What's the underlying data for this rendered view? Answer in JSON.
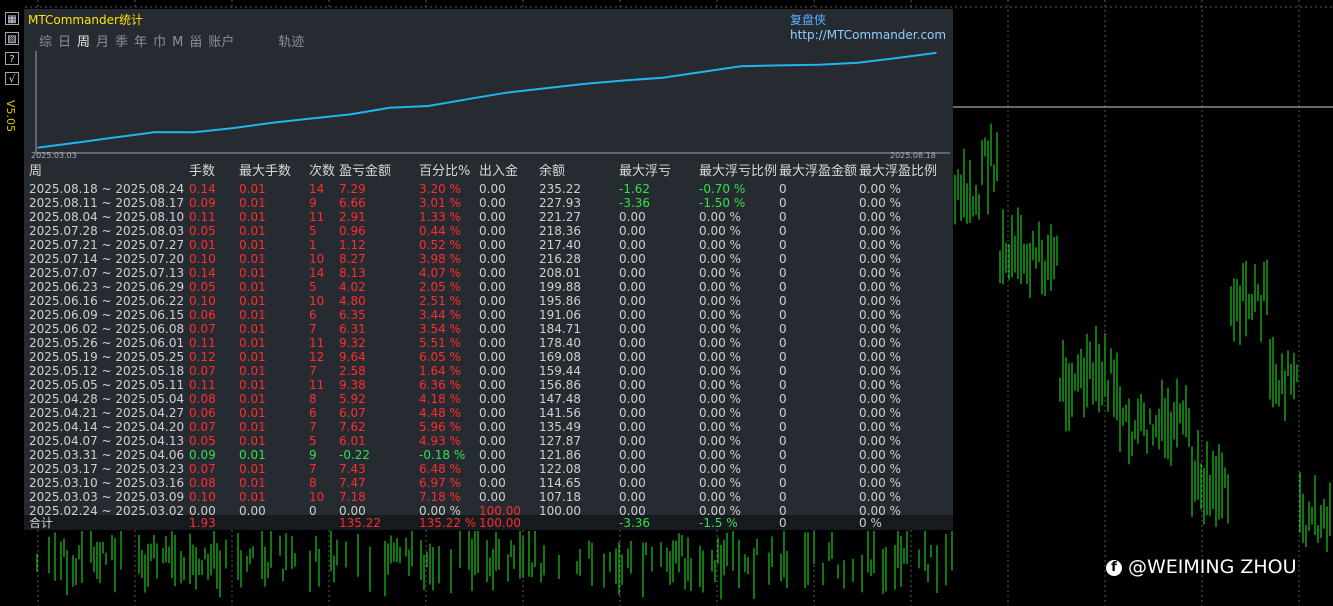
{
  "panel": {
    "title": "MTCommander统计",
    "brand": "复盘侠",
    "url": "http://MTCommander.com",
    "version": "V5.05"
  },
  "toolbar_icons": [
    "grid-icon",
    "calculator-icon",
    "help-icon",
    "check-icon"
  ],
  "toolbar_glyphs": [
    "▦",
    "▨",
    "?",
    "√"
  ],
  "tabs": [
    "综",
    "日",
    "周",
    "月",
    "季",
    "年",
    "巾",
    "M",
    "甾",
    "账户"
  ],
  "active_tab": 2,
  "trajectory_label": "轨迹",
  "chart_data": {
    "type": "line",
    "x_start_label": "2025.03.03",
    "x_end_label": "2025.08.18",
    "values": [
      100.0,
      107.18,
      114.65,
      122.08,
      121.86,
      127.87,
      135.49,
      141.56,
      147.48,
      156.86,
      159.44,
      169.08,
      178.4,
      184.71,
      191.06,
      195.86,
      199.88,
      208.01,
      216.28,
      217.4,
      218.36,
      221.27,
      227.93,
      235.22
    ],
    "ylim": [
      98,
      238
    ],
    "color": "#1fb5f0"
  },
  "table": {
    "headers": [
      "周",
      "手数",
      "最大手数",
      "次数",
      "盈亏金额",
      "百分比%",
      "出入金",
      "余额",
      "最大浮亏",
      "最大浮亏比例",
      "最大浮盈金额",
      "最大浮盈比例"
    ],
    "rows": [
      [
        "2025.08.18 ~ 2025.08.24",
        "0.14",
        "0.01",
        "14",
        "7.29",
        "3.20 %",
        "0.00",
        "235.22",
        "-1.62",
        "-0.70 %",
        "0",
        "0.00 %"
      ],
      [
        "2025.08.11 ~ 2025.08.17",
        "0.09",
        "0.01",
        "9",
        "6.66",
        "3.01 %",
        "0.00",
        "227.93",
        "-3.36",
        "-1.50 %",
        "0",
        "0.00 %"
      ],
      [
        "2025.08.04 ~ 2025.08.10",
        "0.11",
        "0.01",
        "11",
        "2.91",
        "1.33 %",
        "0.00",
        "221.27",
        "0.00",
        "0.00 %",
        "0",
        "0.00 %"
      ],
      [
        "2025.07.28 ~ 2025.08.03",
        "0.05",
        "0.01",
        "5",
        "0.96",
        "0.44 %",
        "0.00",
        "218.36",
        "0.00",
        "0.00 %",
        "0",
        "0.00 %"
      ],
      [
        "2025.07.21 ~ 2025.07.27",
        "0.01",
        "0.01",
        "1",
        "1.12",
        "0.52 %",
        "0.00",
        "217.40",
        "0.00",
        "0.00 %",
        "0",
        "0.00 %"
      ],
      [
        "2025.07.14 ~ 2025.07.20",
        "0.10",
        "0.01",
        "10",
        "8.27",
        "3.98 %",
        "0.00",
        "216.28",
        "0.00",
        "0.00 %",
        "0",
        "0.00 %"
      ],
      [
        "2025.07.07 ~ 2025.07.13",
        "0.14",
        "0.01",
        "14",
        "8.13",
        "4.07 %",
        "0.00",
        "208.01",
        "0.00",
        "0.00 %",
        "0",
        "0.00 %"
      ],
      [
        "2025.06.23 ~ 2025.06.29",
        "0.05",
        "0.01",
        "5",
        "4.02",
        "2.05 %",
        "0.00",
        "199.88",
        "0.00",
        "0.00 %",
        "0",
        "0.00 %"
      ],
      [
        "2025.06.16 ~ 2025.06.22",
        "0.10",
        "0.01",
        "10",
        "4.80",
        "2.51 %",
        "0.00",
        "195.86",
        "0.00",
        "0.00 %",
        "0",
        "0.00 %"
      ],
      [
        "2025.06.09 ~ 2025.06.15",
        "0.06",
        "0.01",
        "6",
        "6.35",
        "3.44 %",
        "0.00",
        "191.06",
        "0.00",
        "0.00 %",
        "0",
        "0.00 %"
      ],
      [
        "2025.06.02 ~ 2025.06.08",
        "0.07",
        "0.01",
        "7",
        "6.31",
        "3.54 %",
        "0.00",
        "184.71",
        "0.00",
        "0.00 %",
        "0",
        "0.00 %"
      ],
      [
        "2025.05.26 ~ 2025.06.01",
        "0.11",
        "0.01",
        "11",
        "9.32",
        "5.51 %",
        "0.00",
        "178.40",
        "0.00",
        "0.00 %",
        "0",
        "0.00 %"
      ],
      [
        "2025.05.19 ~ 2025.05.25",
        "0.12",
        "0.01",
        "12",
        "9.64",
        "6.05 %",
        "0.00",
        "169.08",
        "0.00",
        "0.00 %",
        "0",
        "0.00 %"
      ],
      [
        "2025.05.12 ~ 2025.05.18",
        "0.07",
        "0.01",
        "7",
        "2.58",
        "1.64 %",
        "0.00",
        "159.44",
        "0.00",
        "0.00 %",
        "0",
        "0.00 %"
      ],
      [
        "2025.05.05 ~ 2025.05.11",
        "0.11",
        "0.01",
        "11",
        "9.38",
        "6.36 %",
        "0.00",
        "156.86",
        "0.00",
        "0.00 %",
        "0",
        "0.00 %"
      ],
      [
        "2025.04.28 ~ 2025.05.04",
        "0.08",
        "0.01",
        "8",
        "5.92",
        "4.18 %",
        "0.00",
        "147.48",
        "0.00",
        "0.00 %",
        "0",
        "0.00 %"
      ],
      [
        "2025.04.21 ~ 2025.04.27",
        "0.06",
        "0.01",
        "6",
        "6.07",
        "4.48 %",
        "0.00",
        "141.56",
        "0.00",
        "0.00 %",
        "0",
        "0.00 %"
      ],
      [
        "2025.04.14 ~ 2025.04.20",
        "0.07",
        "0.01",
        "7",
        "7.62",
        "5.96 %",
        "0.00",
        "135.49",
        "0.00",
        "0.00 %",
        "0",
        "0.00 %"
      ],
      [
        "2025.04.07 ~ 2025.04.13",
        "0.05",
        "0.01",
        "5",
        "6.01",
        "4.93 %",
        "0.00",
        "127.87",
        "0.00",
        "0.00 %",
        "0",
        "0.00 %"
      ],
      [
        "2025.03.31 ~ 2025.04.06",
        "0.09",
        "0.01",
        "9",
        "-0.22",
        "-0.18 %",
        "0.00",
        "121.86",
        "0.00",
        "0.00 %",
        "0",
        "0.00 %"
      ],
      [
        "2025.03.17 ~ 2025.03.23",
        "0.07",
        "0.01",
        "7",
        "7.43",
        "6.48 %",
        "0.00",
        "122.08",
        "0.00",
        "0.00 %",
        "0",
        "0.00 %"
      ],
      [
        "2025.03.10 ~ 2025.03.16",
        "0.08",
        "0.01",
        "8",
        "7.47",
        "6.97 %",
        "0.00",
        "114.65",
        "0.00",
        "0.00 %",
        "0",
        "0.00 %"
      ],
      [
        "2025.03.03 ~ 2025.03.09",
        "0.10",
        "0.01",
        "10",
        "7.18",
        "7.18 %",
        "0.00",
        "107.18",
        "0.00",
        "0.00 %",
        "0",
        "0.00 %"
      ],
      [
        "2025.02.24 ~ 2025.03.02",
        "0.00",
        "0.00",
        "0",
        "0.00",
        "0.00 %",
        "100.00",
        "100.00",
        "0.00",
        "0.00 %",
        "0",
        "0.00 %"
      ]
    ],
    "total": [
      "合计",
      "1.93",
      "",
      "",
      "135.22",
      "135.22 %",
      "100.00",
      "",
      "-3.36",
      "-1.5 %",
      "0",
      "0 %"
    ]
  },
  "colors": {
    "profit": "#ff2d2d",
    "loss": "#33e04b",
    "neutral": "#d0d0d0",
    "title": "#ffe200",
    "brand": "#57b0ff"
  },
  "watermark": {
    "icon": "facebook-icon",
    "text": "@WEIMING ZHOU"
  }
}
